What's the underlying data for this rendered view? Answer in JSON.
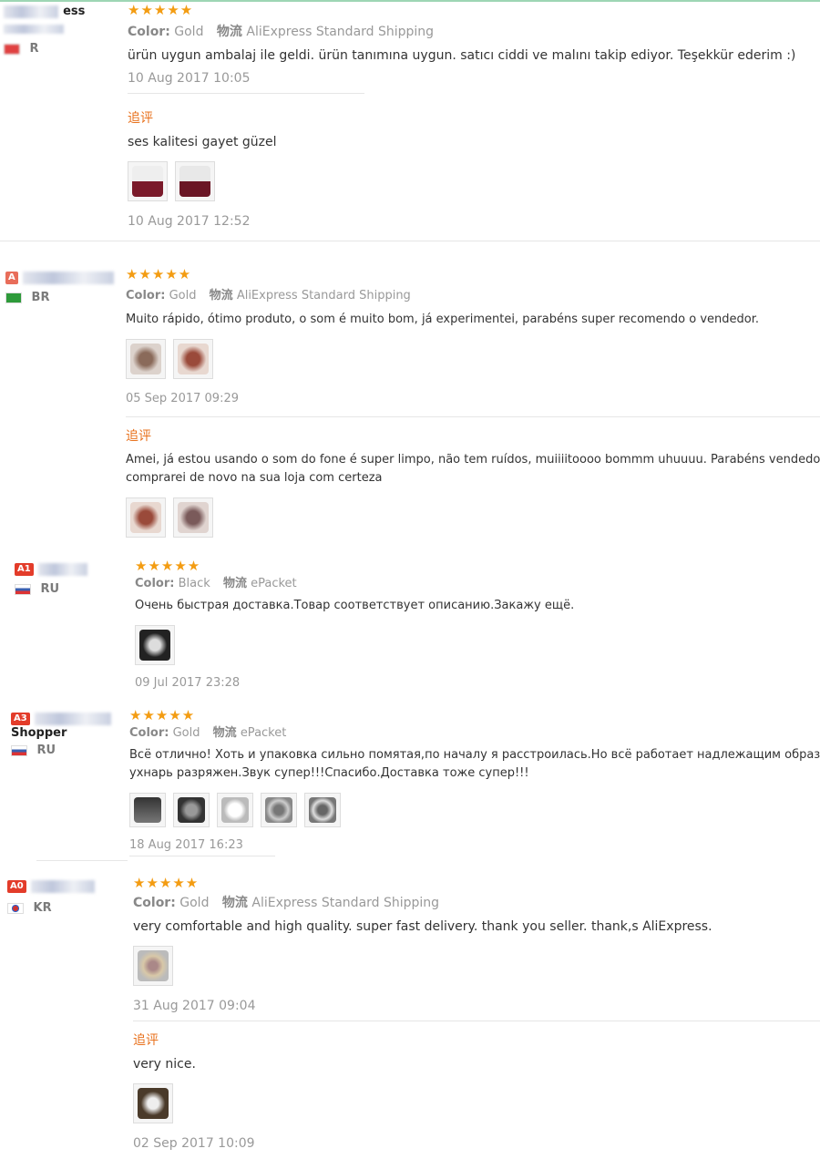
{
  "labels": {
    "color": "Color:",
    "logistics": "物流",
    "followup": "追评"
  },
  "stars_glyph": "★★★★★",
  "reviews": [
    {
      "buyer_name": "ess",
      "country": "R",
      "color": "Gold",
      "shipping": "AliExpress Standard Shipping",
      "text": "ürün uygun ambalaj ile geldi. ürün tanımına uygun. satıcı ciddi ve malını takip ediyor. Teşekkür ederim :)",
      "date": "10 Aug 2017 10:05",
      "followup_text": "ses kalitesi gayet güzel",
      "followup_date": "10 Aug 2017 12:52"
    },
    {
      "buyer_name": "",
      "country": "BR",
      "color": "Gold",
      "shipping": "AliExpress Standard Shipping",
      "text": "Muito rápido, ótimo produto, o som é muito bom, já experimentei, parabéns super recomendo o vendedor.",
      "date": "05 Sep 2017 09:29",
      "followup_text_1": "Amei, já estou usando o som do fone é super limpo, não tem ruídos, muiiiitoooo bommm uhuuuu. Parabéns vendedor",
      "followup_text_2": "comprarei de novo na sua loja com certeza"
    },
    {
      "badge": "A1",
      "buyer_name": "",
      "country": "RU",
      "color": "Black",
      "shipping": "ePacket",
      "text": "Очень быстрая доставка.Товар соответствует описанию.Закажу ещё.",
      "date": "09 Jul 2017 23:28"
    },
    {
      "badge": "A3",
      "buyer_name": "Shopper",
      "country": "RU",
      "color": "Gold",
      "shipping": "ePacket",
      "text_1": "Всё отлично! Хоть и упаковка сильно помятая,по началу я расстроилась.Но всё работает надлежащим образом",
      "text_2": "ухнарь разряжен.Звук супер!!!Спасибо.Доставка тоже супер!!!",
      "date": "18 Aug 2017 16:23"
    },
    {
      "badge": "A0",
      "buyer_name": "",
      "country": "KR",
      "color": "Gold",
      "shipping": "AliExpress Standard Shipping",
      "text": "very comfortable and high quality. super fast delivery. thank you seller. thank,s AliExpress.",
      "date": "31 Aug 2017 09:04",
      "followup_text": "very nice.",
      "followup_date": "02 Sep 2017 10:09"
    }
  ],
  "colors": {
    "star": "#f39c12",
    "followup": "#e8711c",
    "badge": "#e33c2a"
  }
}
